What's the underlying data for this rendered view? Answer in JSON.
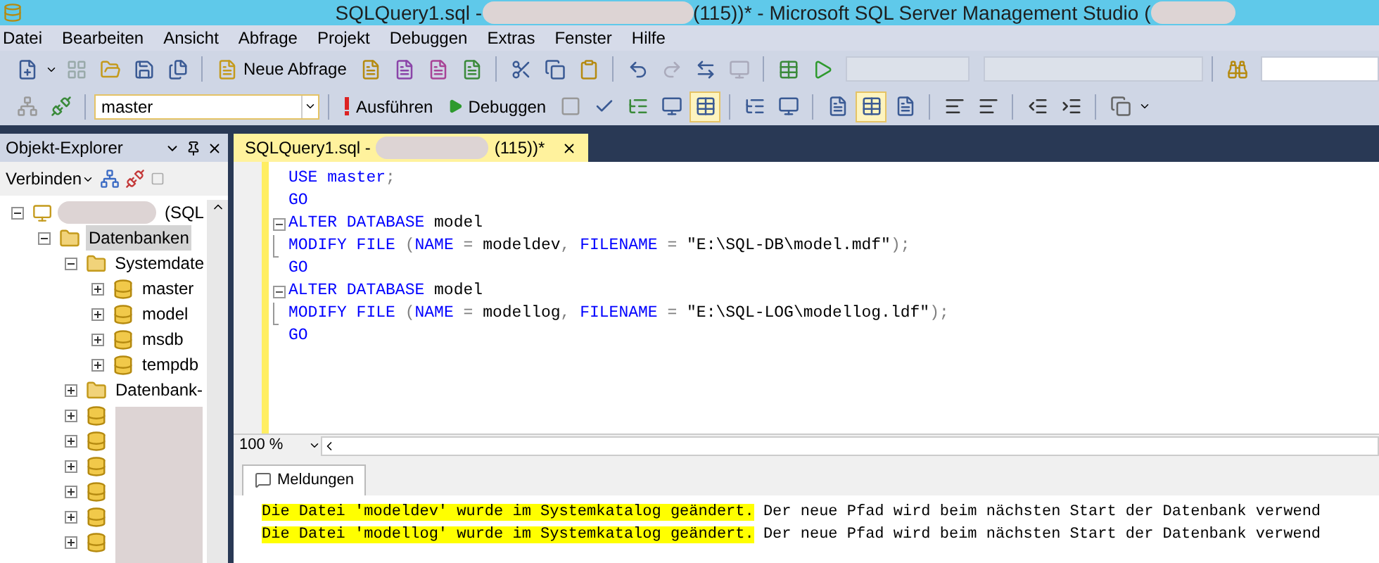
{
  "window": {
    "title_before": "SQLQuery1.sql - ",
    "title_after": "(115))* - Microsoft SQL Server Management Studio ("
  },
  "menu": [
    "Datei",
    "Bearbeiten",
    "Ansicht",
    "Abfrage",
    "Projekt",
    "Debuggen",
    "Extras",
    "Fenster",
    "Hilfe"
  ],
  "toolbar": {
    "new_query": "Neue Abfrage"
  },
  "query_toolbar": {
    "database": "master",
    "execute": "Ausführen",
    "debug": "Debuggen"
  },
  "object_explorer": {
    "title": "Objekt-Explorer",
    "connect": "Verbinden",
    "tree": [
      {
        "kind": "server",
        "label": "(SQL",
        "expanded": true,
        "selected": false,
        "children": [
          {
            "kind": "folder",
            "label": "Datenbanken",
            "expanded": true,
            "selected": true,
            "children": [
              {
                "kind": "folder",
                "label": "Systemdate",
                "expanded": true,
                "selected": false,
                "children": [
                  {
                    "kind": "database",
                    "label": "master",
                    "expanded": false,
                    "selected": false
                  },
                  {
                    "kind": "database",
                    "label": "model",
                    "expanded": false,
                    "selected": false
                  },
                  {
                    "kind": "database",
                    "label": "msdb",
                    "expanded": false,
                    "selected": false
                  },
                  {
                    "kind": "database",
                    "label": "tempdb",
                    "expanded": false,
                    "selected": false
                  }
                ]
              },
              {
                "kind": "folder",
                "label": "Datenbank-",
                "expanded": false,
                "selected": false
              },
              {
                "kind": "database",
                "expanded": false,
                "selected": false
              },
              {
                "kind": "database",
                "expanded": false,
                "selected": false
              },
              {
                "kind": "database",
                "expanded": false,
                "selected": false
              },
              {
                "kind": "database",
                "expanded": false,
                "selected": false
              },
              {
                "kind": "database",
                "expanded": false,
                "selected": false
              },
              {
                "kind": "database",
                "expanded": false,
                "selected": false
              }
            ]
          }
        ]
      }
    ]
  },
  "editor": {
    "tab": {
      "title_before": "SQLQuery1.sql - ",
      "title_after": "(115))*",
      "selected": true
    },
    "lines": [
      {
        "kind": "plain",
        "tokens": [
          {
            "kind": "keyword",
            "text": "USE master"
          },
          {
            "kind": "operator",
            "text": ";"
          }
        ]
      },
      {
        "kind": "plain",
        "tokens": [
          {
            "kind": "keyword",
            "text": "GO"
          }
        ]
      },
      {
        "kind": "fold_start",
        "tokens": [
          {
            "kind": "keyword",
            "text": "ALTER DATABASE "
          },
          {
            "kind": "plain",
            "text": "model"
          }
        ]
      },
      {
        "kind": "fold_end",
        "tokens": [
          {
            "kind": "keyword",
            "text": "MODIFY FILE "
          },
          {
            "kind": "operator",
            "text": "("
          },
          {
            "kind": "keyword",
            "text": "NAME "
          },
          {
            "kind": "operator",
            "text": "= "
          },
          {
            "kind": "plain",
            "text": "modeldev"
          },
          {
            "kind": "operator",
            "text": ", "
          },
          {
            "kind": "keyword",
            "text": "FILENAME "
          },
          {
            "kind": "operator",
            "text": "= "
          },
          {
            "kind": "plain",
            "text": "\"E:\\SQL-DB\\model.mdf\""
          },
          {
            "kind": "operator",
            "text": ");"
          }
        ]
      },
      {
        "kind": "plain",
        "tokens": [
          {
            "kind": "keyword",
            "text": "GO"
          }
        ]
      },
      {
        "kind": "fold_start",
        "tokens": [
          {
            "kind": "keyword",
            "text": "ALTER DATABASE "
          },
          {
            "kind": "plain",
            "text": "model"
          }
        ]
      },
      {
        "kind": "fold_end",
        "tokens": [
          {
            "kind": "keyword",
            "text": "MODIFY FILE "
          },
          {
            "kind": "operator",
            "text": "("
          },
          {
            "kind": "keyword",
            "text": "NAME "
          },
          {
            "kind": "operator",
            "text": "= "
          },
          {
            "kind": "plain",
            "text": "modellog"
          },
          {
            "kind": "operator",
            "text": ", "
          },
          {
            "kind": "keyword",
            "text": "FILENAME "
          },
          {
            "kind": "operator",
            "text": "= "
          },
          {
            "kind": "plain",
            "text": "\"E:\\SQL-LOG\\modellog.ldf\""
          },
          {
            "kind": "operator",
            "text": ");"
          }
        ]
      },
      {
        "kind": "plain",
        "tokens": [
          {
            "kind": "keyword",
            "text": "GO"
          }
        ]
      }
    ],
    "zoom": "100 %"
  },
  "results": {
    "tab": {
      "label": "Meldungen",
      "selected": true
    },
    "messages": [
      {
        "highlighted": "Die Datei 'modeldev' wurde im Systemkatalog geändert.",
        "rest": " Der neue Pfad wird beim nächsten Start der Datenbank verwend"
      },
      {
        "highlighted": "Die Datei 'modellog' wurde im Systemkatalog geändert.",
        "rest": " Der neue Pfad wird beim nächsten Start der Datenbank verwend"
      }
    ]
  }
}
